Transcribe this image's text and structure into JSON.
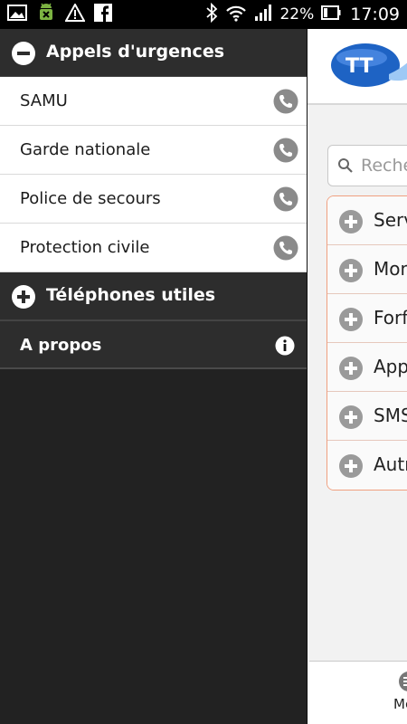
{
  "status_bar": {
    "left_icons": [
      "image-icon",
      "android-debug-icon",
      "warning-icon",
      "facebook-icon"
    ],
    "right_icons": [
      "bluetooth-icon",
      "wifi-icon",
      "signal-icon",
      "battery-icon"
    ],
    "battery_percent": "22%",
    "time": "17:09"
  },
  "drawer": {
    "emergency_section": {
      "title": "Appels d'urgences",
      "expanded": true,
      "items": [
        {
          "label": "SAMU"
        },
        {
          "label": "Garde nationale"
        },
        {
          "label": "Police de secours"
        },
        {
          "label": "Protection civile"
        }
      ]
    },
    "useful_phones_section": {
      "title": "Téléphones utiles",
      "expanded": false
    },
    "about": {
      "label": "A propos"
    }
  },
  "app": {
    "search": {
      "placeholder": "Reche"
    },
    "menu": [
      {
        "label": "Serv"
      },
      {
        "label": "Mon"
      },
      {
        "label": "Forfa"
      },
      {
        "label": "Appe"
      },
      {
        "label": "SMS"
      },
      {
        "label": "Autr"
      }
    ],
    "bottom_bar": {
      "label": "Me"
    }
  },
  "colors": {
    "drawer_bg": "#222222",
    "header_bg": "#2d2d2d",
    "item_bg": "#ffffff",
    "menu_border": "#f0a080",
    "logo_blue": "#1e63c4"
  }
}
